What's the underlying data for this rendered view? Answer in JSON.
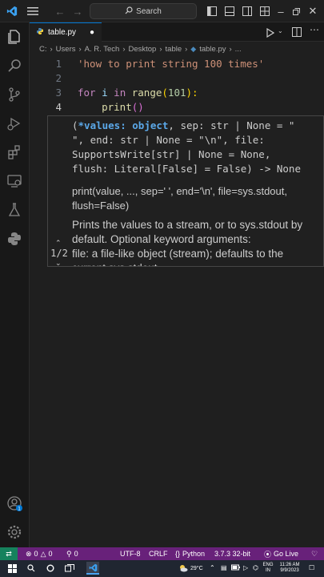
{
  "titlebar": {
    "search_label": "Search"
  },
  "tab": {
    "filename": "table.py"
  },
  "breadcrumb": {
    "items": [
      "C:",
      "Users",
      "A. R. Tech",
      "Desktop",
      "table",
      "table.py",
      "..."
    ]
  },
  "editor": {
    "lines": [
      {
        "number": "1",
        "tokens": [
          {
            "text": "'how to print string 100 times'",
            "color": "#ce9178"
          }
        ]
      },
      {
        "number": "2",
        "tokens": []
      },
      {
        "number": "3",
        "tokens": [
          {
            "text": "for ",
            "color": "#c586c0"
          },
          {
            "text": "i ",
            "color": "#9cdcfe"
          },
          {
            "text": "in ",
            "color": "#c586c0"
          },
          {
            "text": "range",
            "color": "#dcdcaa"
          },
          {
            "text": "(",
            "color": "#ffd700"
          },
          {
            "text": "101",
            "color": "#b5cea8"
          },
          {
            "text": "):",
            "color": "#ffd700"
          }
        ]
      },
      {
        "number": "4",
        "tokens": [
          {
            "text": "    print",
            "color": "#dcdcaa"
          },
          {
            "text": "()",
            "color": "#da70d6"
          }
        ]
      }
    ]
  },
  "hover": {
    "counter": "1/2",
    "signature_param": "*values: object",
    "signature_rest": ", sep: str | None = \"\n\", end: str | None = \"\\n\", file:\nSupportsWrite[str] | None = None,\nflush: Literal[False] = False) -> None",
    "signature_open": "(",
    "doc_sig": "print(value, ..., sep=' ', end='\\n', file=sys.stdout, flush=False)",
    "doc_desc": "Prints the values to a stream, or to sys.stdout by default. Optional keyword arguments:",
    "doc_file": "file: a file-like object (stream); defaults to the current sys.stdout."
  },
  "statusbar": {
    "errors": "0",
    "warnings": "0",
    "ports": "0",
    "encoding": "UTF-8",
    "eol": "CRLF",
    "language": "Python",
    "interpreter": "3.7.3 32-bit",
    "golive": "Go Live"
  },
  "taskbar": {
    "weather": "29°C",
    "lang": "ENG",
    "region": "IN",
    "time": "11:26 AM",
    "date": "9/9/2023"
  },
  "colors": {
    "accent": "#0078d4",
    "statusbar": "#68217a"
  }
}
